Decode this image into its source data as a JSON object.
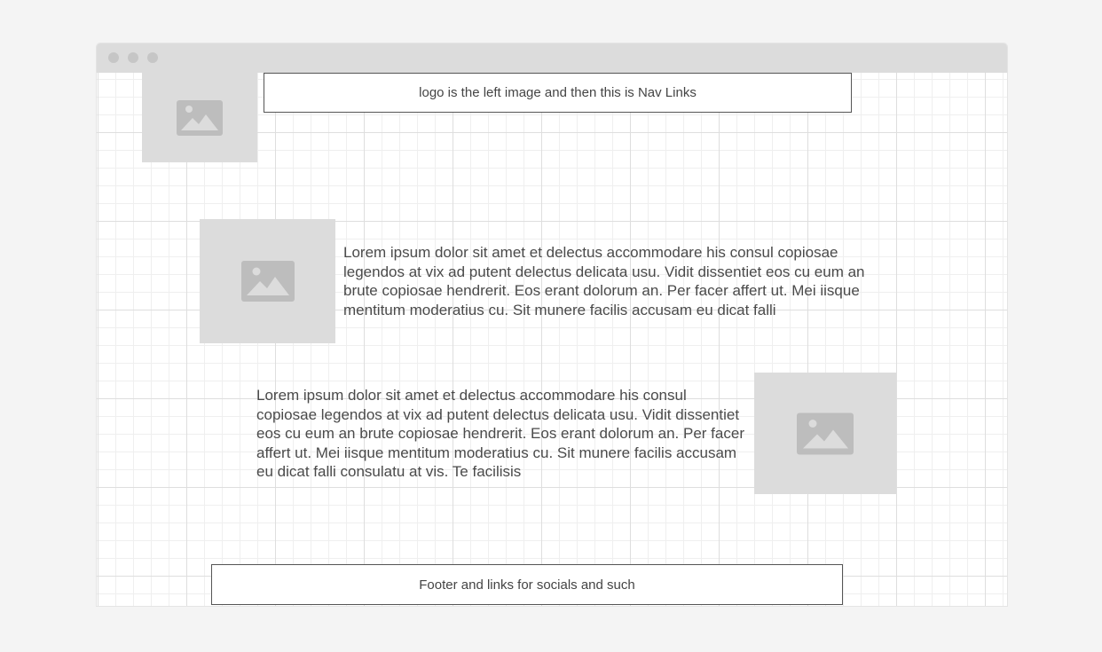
{
  "window": {
    "traffic_lights": [
      "close",
      "minimize",
      "maximize"
    ]
  },
  "header": {
    "logo_icon": "image-placeholder-icon",
    "nav_text": "logo is the left image and then this is Nav Links"
  },
  "sections": [
    {
      "image_icon": "image-placeholder-icon",
      "text": "Lorem ipsum dolor sit amet et delectus accommodare his consul copiosae legendos at vix ad putent delectus delicata usu. Vidit dissentiet eos cu eum an brute copiosae hendrerit. Eos erant dolorum an. Per facer affert ut. Mei iisque mentitum moderatius cu. Sit munere facilis accusam eu dicat falli"
    },
    {
      "image_icon": "image-placeholder-icon",
      "text": "Lorem ipsum dolor sit amet et delectus accommodare his consul copiosae legendos at vix ad putent delectus delicata usu. Vidit dissentiet eos cu eum an brute copiosae hendrerit. Eos erant dolorum an. Per facer affert ut. Mei iisque mentitum moderatius cu. Sit munere facilis accusam eu dicat falli consulatu at vis. Te facilisis"
    }
  ],
  "footer": {
    "text": "Footer and links for socials and such"
  },
  "colors": {
    "placeholder_fill": "#dcdcdc",
    "placeholder_icon": "#bdbdbd",
    "titlebar": "#dcdcdc",
    "border": "#555555"
  }
}
